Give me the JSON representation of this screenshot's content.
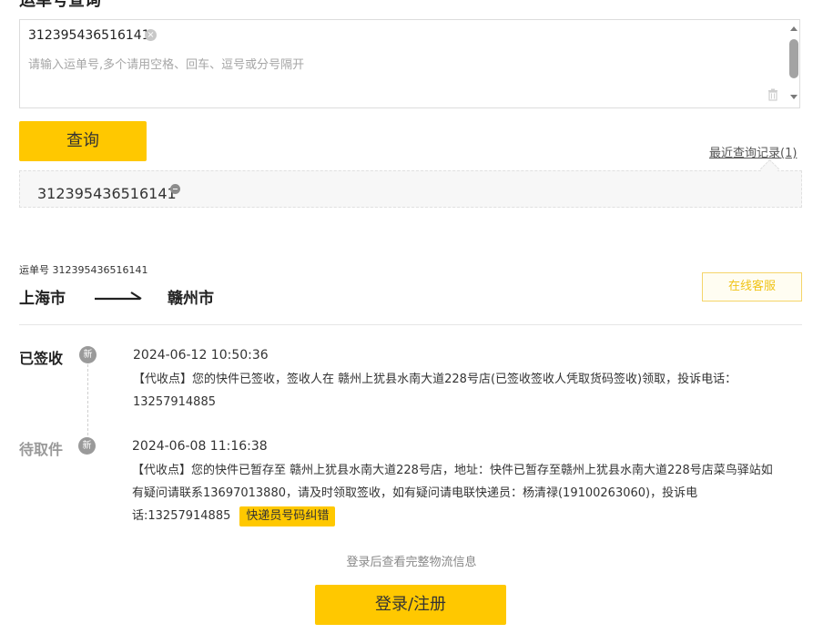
{
  "page_title": "运单号查询",
  "search": {
    "tag_number": "312395436516141",
    "hint": "请输入运单号,多个请用空格、回车、逗号或分号隔开",
    "tag_remove_glyph": "×"
  },
  "query_button_label": "查询",
  "recent": {
    "link_label": "最近查询记录(1)",
    "items": [
      "312395436516141"
    ]
  },
  "waybill": {
    "label": "运单号 312395436516141",
    "from": "上海市",
    "to": "赣州市"
  },
  "service_button_label": "在线客服",
  "timeline": [
    {
      "status": "已签收",
      "badge": "新",
      "time": "2024-06-12 10:50:36",
      "desc": "【代收点】您的快件已签收，签收人在 赣州上犹县水南大道228号店(已签收签收人凭取货码签收)领取，投诉电话：13257914885"
    },
    {
      "status": "待取件",
      "badge": "新",
      "time": "2024-06-08 11:16:38",
      "desc": "【代收点】您的快件已暂存至 赣州上犹县水南大道228号店，地址：快件已暂存至赣州上犹县水南大道228号店菜鸟驿站如有疑问请联系13697013880，请及时领取签收，如有疑问请电联快递员：杨清禄(19100263060)，投诉电话:13257914885"
    }
  ],
  "correct_button_label": "快递员号码纠错",
  "login_hint": "登录后查看完整物流信息",
  "login_button_label": "登录/注册",
  "colors": {
    "accent": "#ffc800",
    "service_text": "#f0c419"
  },
  "icons": {
    "tag_remove": "close-circle-icon",
    "trash": "trash-icon",
    "recent_remove": "minus-circle-icon",
    "route": "arrow-right-icon",
    "new": "new-badge"
  }
}
